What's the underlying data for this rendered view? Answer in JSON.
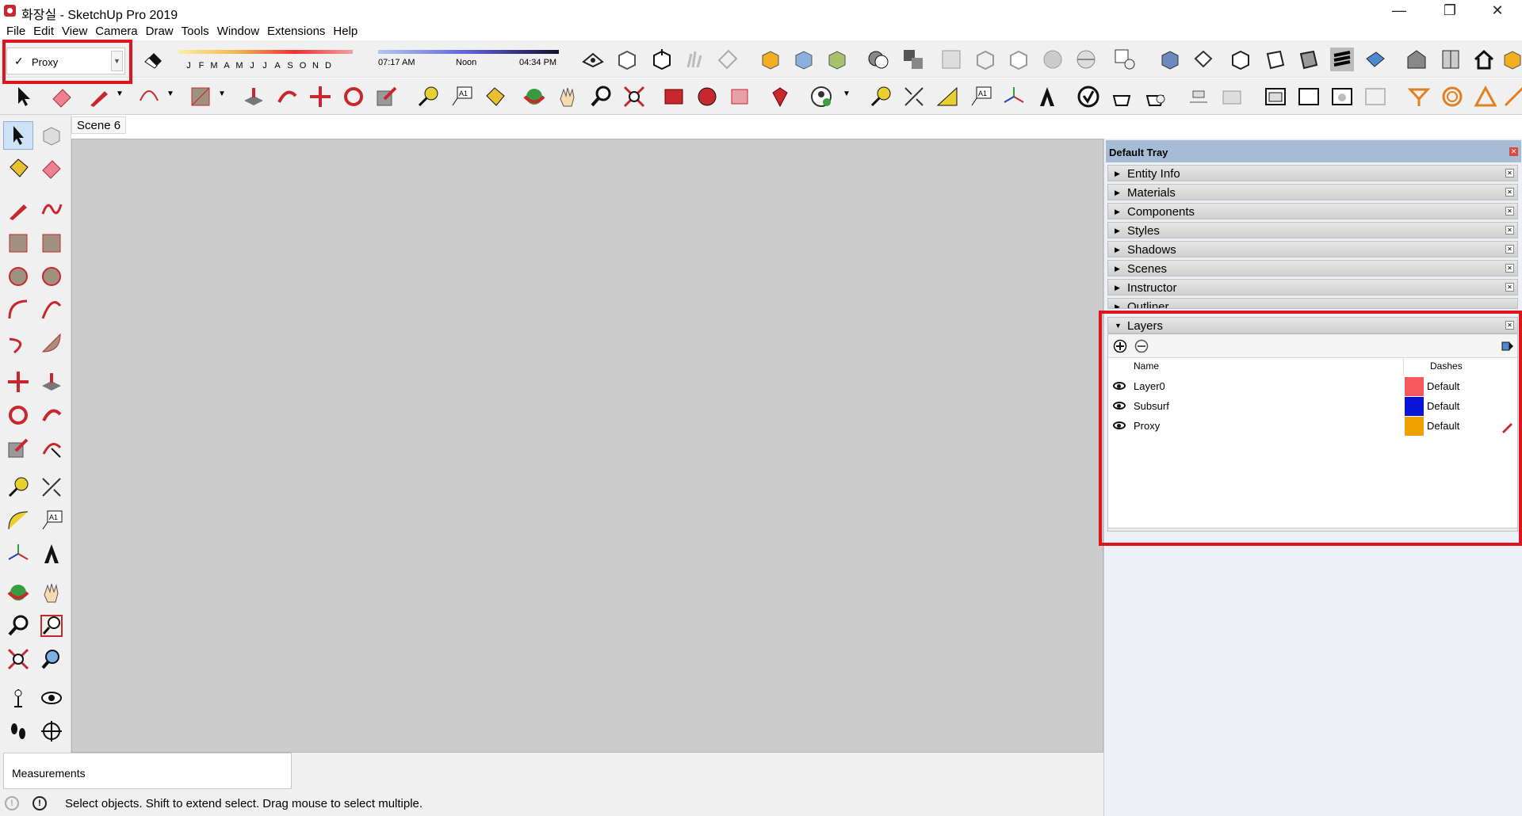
{
  "window": {
    "title": "화장실 - SketchUp Pro 2019",
    "minimize": "—",
    "maximize": "❐",
    "close": "✕"
  },
  "menu": [
    "File",
    "Edit",
    "View",
    "Camera",
    "Draw",
    "Tools",
    "Window",
    "Extensions",
    "Help"
  ],
  "layer_dropdown": {
    "check": "✓",
    "value": "Proxy"
  },
  "shadows": {
    "months": [
      "J",
      "F",
      "M",
      "A",
      "M",
      "J",
      "J",
      "A",
      "S",
      "O",
      "N",
      "D"
    ],
    "time_start": "07:17 AM",
    "time_mid": "Noon",
    "time_end": "04:34 PM"
  },
  "scene_tab": "Scene 6",
  "tray": {
    "title": "Default Tray",
    "panels": [
      "Entity Info",
      "Materials",
      "Components",
      "Styles",
      "Shadows",
      "Scenes",
      "Instructor",
      "Outliner"
    ],
    "layers": {
      "title": "Layers",
      "col_name": "Name",
      "col_dashes": "Dashes",
      "rows": [
        {
          "name": "Layer0",
          "color": "#f5595d",
          "dashes": "Default"
        },
        {
          "name": "Subsurf",
          "color": "#0a14d8",
          "dashes": "Default"
        },
        {
          "name": "Proxy",
          "color": "#f0a000",
          "dashes": "Default"
        }
      ]
    }
  },
  "status": {
    "measurements_label": "Measurements",
    "message": "Select objects. Shift to extend select. Drag mouse to select multiple."
  },
  "colors": {
    "highlight": "#e0141e",
    "viewport": "#cccccc",
    "tray_header": "#a6bcd6"
  }
}
